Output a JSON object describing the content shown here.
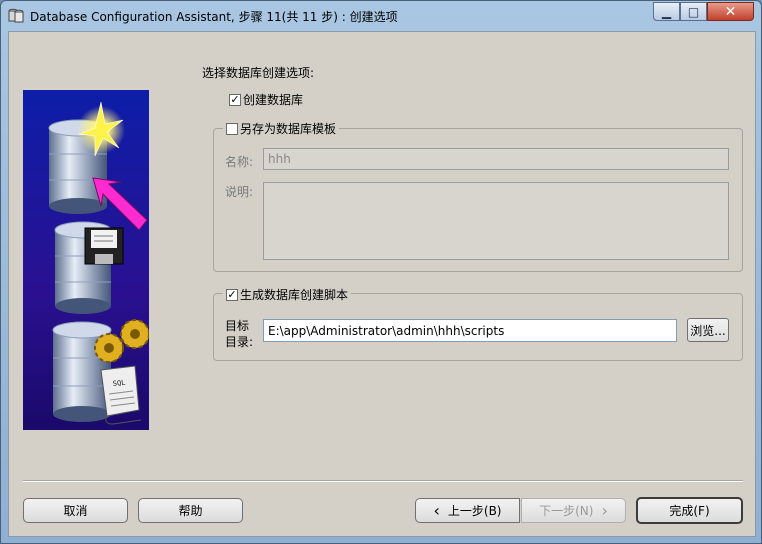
{
  "window": {
    "title": "Database Configuration Assistant, 步骤 11(共 11 步) : 创建选项",
    "minimize_glyph": "▁",
    "maximize_glyph": "□",
    "close_glyph": "✕"
  },
  "main": {
    "prompt": "选择数据库创建选项:",
    "create_db": {
      "label": "创建数据库",
      "checked": true
    },
    "save_template": {
      "label": "另存为数据库模板",
      "checked": false,
      "name_label": "名称:",
      "name_value": "hhh",
      "desc_label": "说明:",
      "desc_value": ""
    },
    "gen_scripts": {
      "label": "生成数据库创建脚本",
      "checked": true,
      "dest_label_line1": "目标",
      "dest_label_line2": "目录:",
      "dest_value": "E:\\app\\Administrator\\admin\\hhh\\scripts",
      "browse_label": "浏览..."
    },
    "check_glyph": "✓"
  },
  "footer": {
    "cancel": "取消",
    "help": "帮助",
    "back": "上一步(B)",
    "back_glyph": "‹",
    "next": "下一步(N)",
    "next_glyph": "›",
    "finish": "完成(F)"
  },
  "colors": {
    "accent_magenta": "#ff2ad0",
    "panel_blue": "#0d1ea8"
  }
}
